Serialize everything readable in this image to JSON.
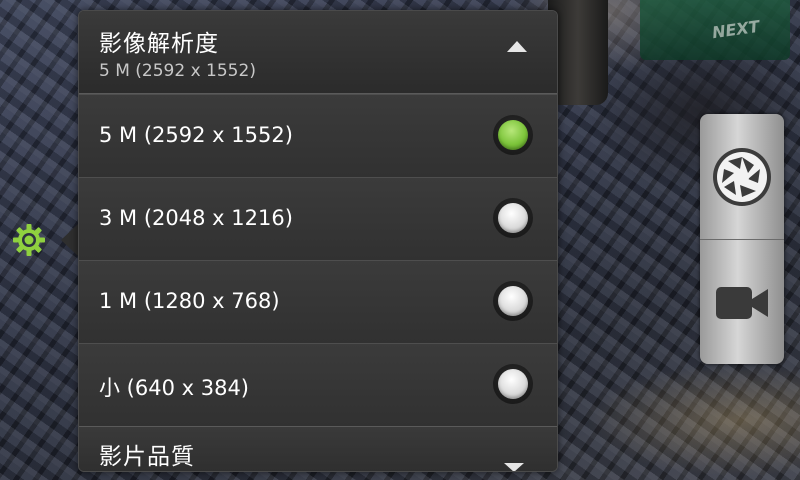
{
  "settings": {
    "gear_icon": "gear-icon",
    "accent_color": "#7cc43a"
  },
  "popup": {
    "title": "影像解析度",
    "current_value": "5 M (2592 x 1552)",
    "options": [
      {
        "label": "5 M (2592 x 1552)",
        "selected": true
      },
      {
        "label": "3 M (2048 x 1216)",
        "selected": false
      },
      {
        "label": "1 M (1280 x 768)",
        "selected": false
      },
      {
        "label": "小 (640 x 384)",
        "selected": false
      }
    ],
    "next_section_title": "影片品質"
  },
  "background": {
    "label": "NEXT"
  },
  "mode_switcher": {
    "photo_icon": "camera-shutter-icon",
    "video_icon": "video-camera-icon"
  }
}
